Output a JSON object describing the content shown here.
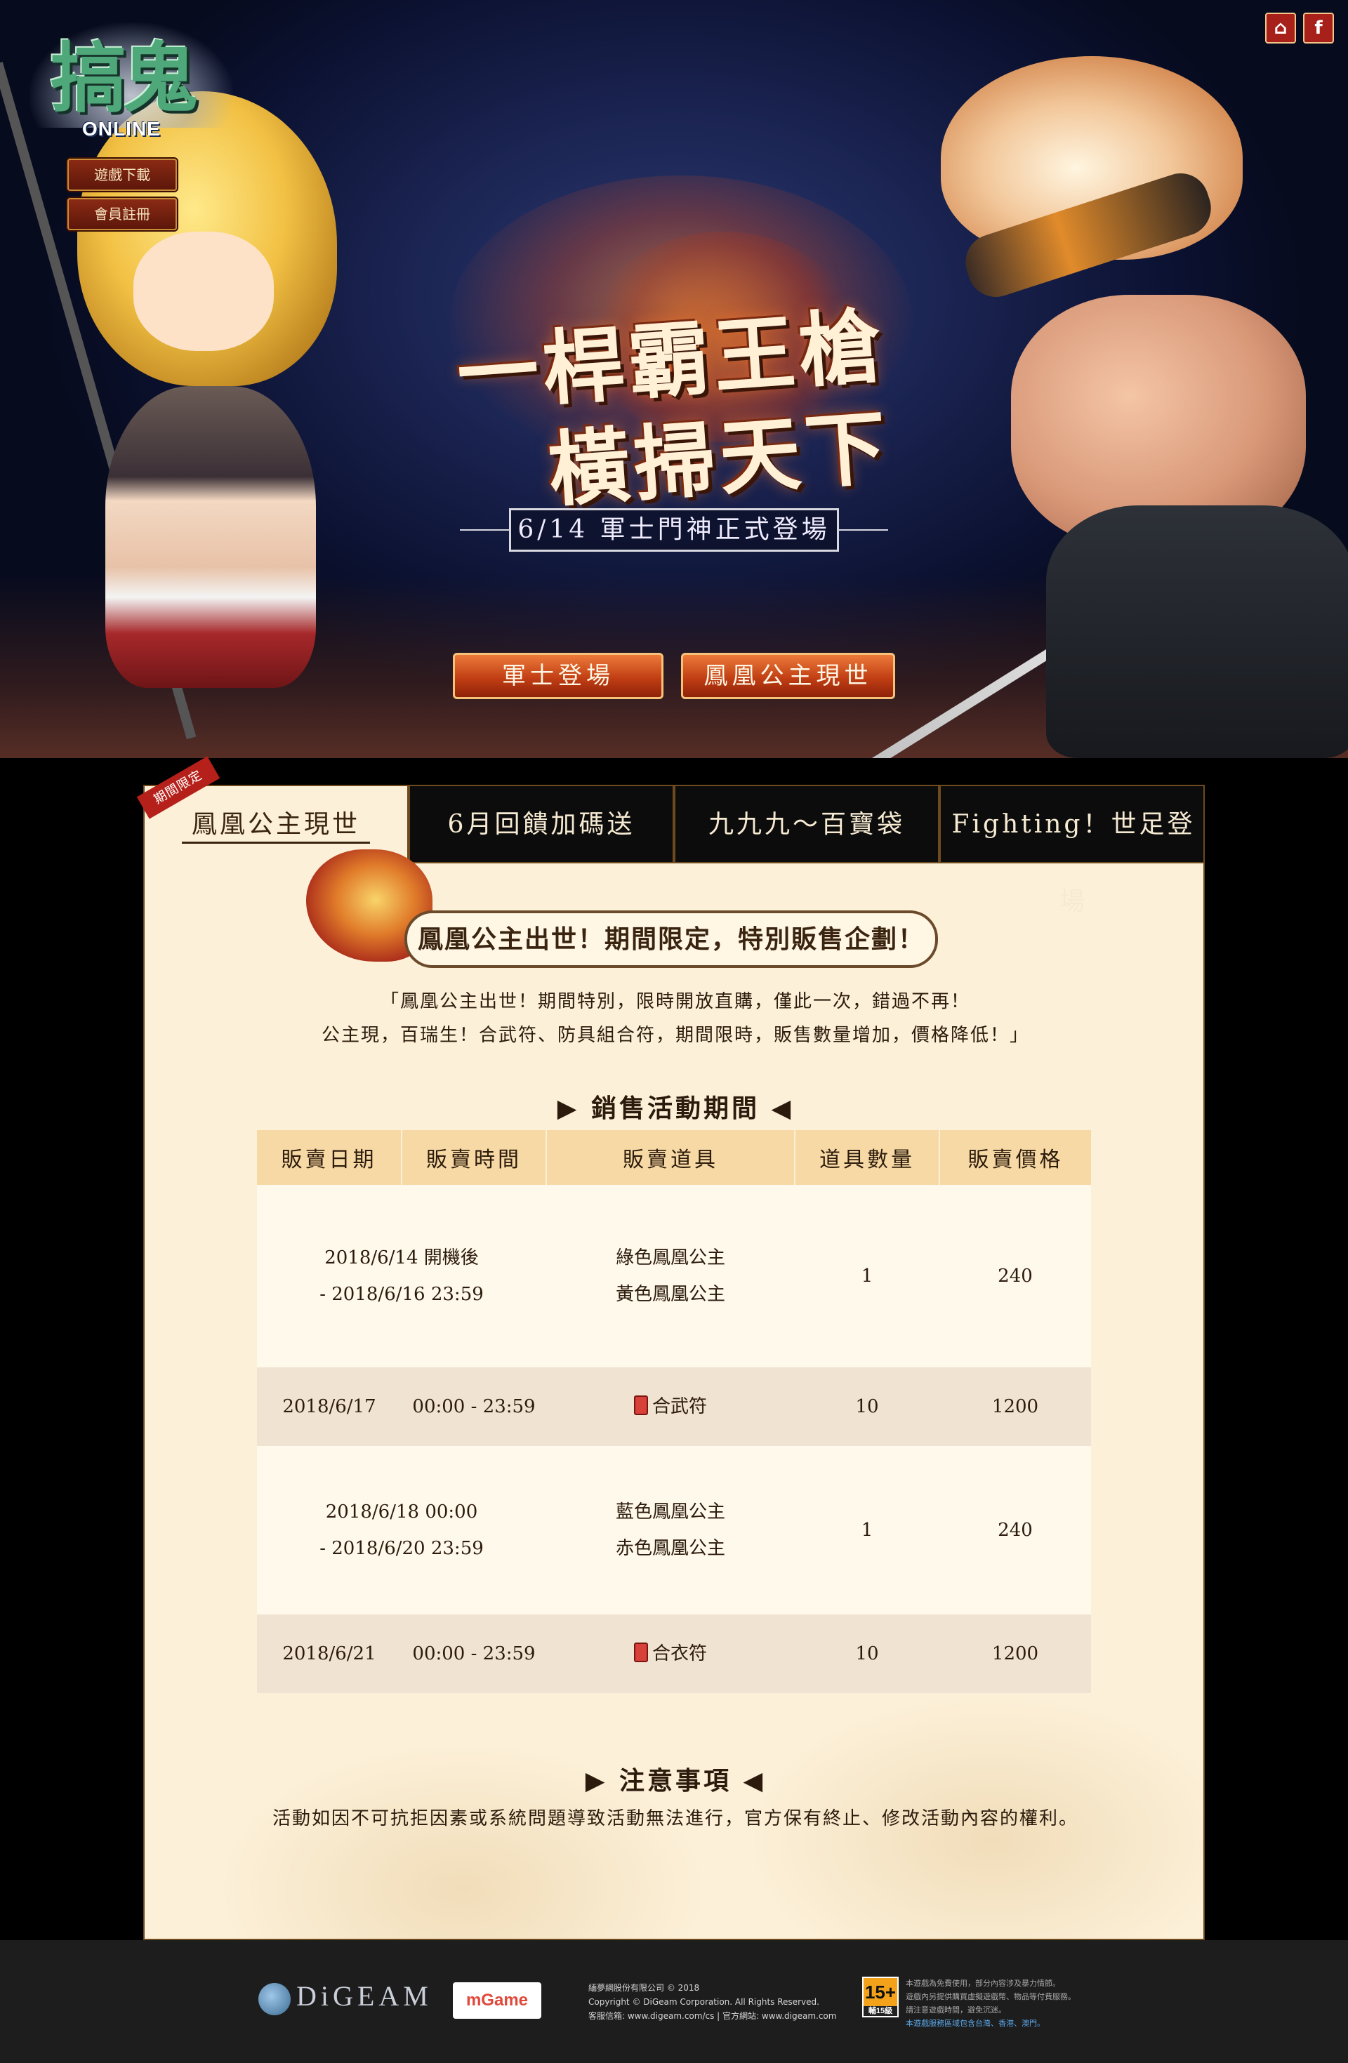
{
  "hero": {
    "logo_main": "搞鬼",
    "logo_sub": "ONLINE",
    "side_buttons": [
      "遊戲下載",
      "會員註冊"
    ],
    "corner_icons": [
      "home-icon",
      "facebook-icon"
    ],
    "title_line1": "一桿霸王槍",
    "title_line2": "橫掃天下",
    "date_banner": "6/14 軍士門神正式登場",
    "cta_buttons": [
      "軍士登場",
      "鳳凰公主現世"
    ]
  },
  "event": {
    "ribbon": "期間限定",
    "tabs": [
      "鳳凰公主現世",
      "6月回饋加碼送",
      "九九九～百寶袋",
      "Fighting！世足登場"
    ],
    "active_tab": 0,
    "heading": "鳳凰公主出世！期間限定，特別販售企劃！",
    "intro_line1": "「鳳凰公主出世！期間特別，限時開放直購，僅此一次，錯過不再！",
    "intro_line2": "公主現，百瑞生！合武符、防具組合符，期間限時，販售數量增加，價格降低！」",
    "sales_title": "▶ 銷售活動期間 ◀",
    "table": {
      "headers": [
        "販賣日期",
        "販賣時間",
        "販賣道具",
        "道具數量",
        "販賣價格"
      ],
      "rows": [
        {
          "date_line1": "2018/6/14 開機後",
          "date_line2": "- 2018/6/16 23:59",
          "time": "",
          "items": [
            "綠色鳳凰公主",
            "黃色鳳凰公主"
          ],
          "qty": "1",
          "price": "240"
        },
        {
          "date": "2018/6/17",
          "time": "00:00 - 23:59",
          "item": "合武符",
          "qty": "10",
          "price": "1200"
        },
        {
          "date_line1": "2018/6/18 00:00",
          "date_line2": "- 2018/6/20 23:59",
          "time": "",
          "items": [
            "藍色鳳凰公主",
            "赤色鳳凰公主"
          ],
          "qty": "1",
          "price": "240"
        },
        {
          "date": "2018/6/21",
          "time": "00:00 - 23:59",
          "item": "合衣符",
          "qty": "10",
          "price": "1200"
        }
      ]
    },
    "notice_title": "▶ 注意事項 ◀",
    "notice_text": "活動如因不可抗拒因素或系統問題導致活動無法進行，官方保有終止、修改活動內容的權利。"
  },
  "footer": {
    "digeam_logo": "DiGEAM",
    "mygame_logo": "mGame",
    "copyright_lines": [
      "緬夢網股份有限公司 © 2018",
      "Copyright © DiGeam Corporation. All Rights Reserved.",
      "客服信箱: www.digeam.com/cs | 官方網站: www.digeam.com"
    ],
    "rating": "15+",
    "rating_sub": "輔15級",
    "rating_text": [
      "本遊戲為免費使用，部分內容涉及暴力情節。",
      "遊戲內另提供購買虛擬遊戲幣、物品等付費服務。",
      "請注意遊戲時間，避免沉迷。"
    ],
    "rating_region": "本遊戲服務區域包含台灣、香港、澳門。"
  }
}
